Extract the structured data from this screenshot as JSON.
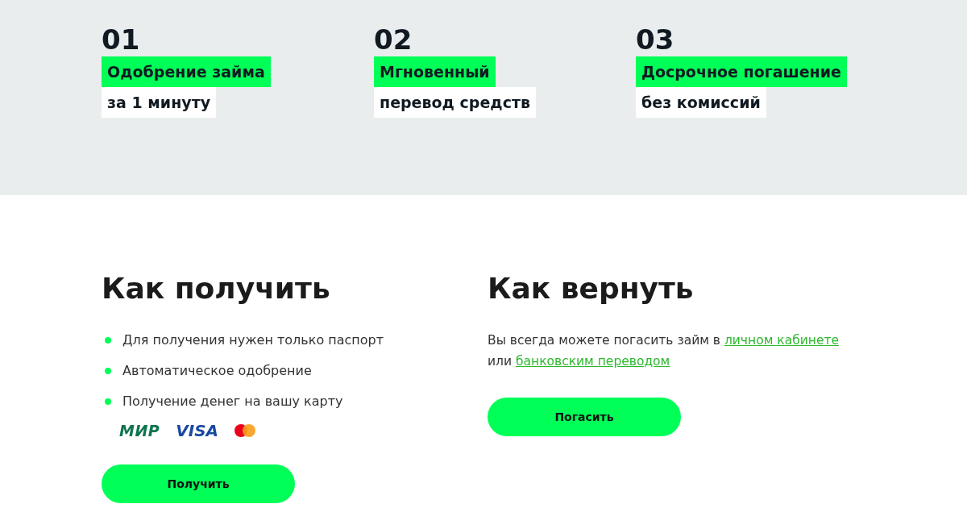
{
  "features": [
    {
      "number": "01",
      "highlight": "Одобрение займа",
      "caption": "за 1 минуту"
    },
    {
      "number": "02",
      "highlight": "Мгновенный",
      "caption": "перевод средств"
    },
    {
      "number": "03",
      "highlight": "Досрочное погашение",
      "caption": "без комиссий"
    }
  ],
  "how_to_get": {
    "title": "Как получить",
    "bullets": [
      "Для получения нужен только паспорт",
      "Автоматическое одобрение",
      "Получение денег на вашу карту"
    ],
    "payment_logos": [
      {
        "kind": "mir",
        "label": "МИР"
      },
      {
        "kind": "visa",
        "label": "VISA"
      },
      {
        "kind": "mastercard"
      }
    ],
    "button": "Получить"
  },
  "how_to_repay": {
    "title": "Как вернуть",
    "paragraph": [
      {
        "kind": "text",
        "text": "Вы всегда можете погасить займ в "
      },
      {
        "kind": "link",
        "text": "личном кабинете"
      },
      {
        "kind": "text",
        "text": " или "
      },
      {
        "kind": "link",
        "text": "банковским переводом"
      }
    ],
    "button": "Погасить"
  }
}
